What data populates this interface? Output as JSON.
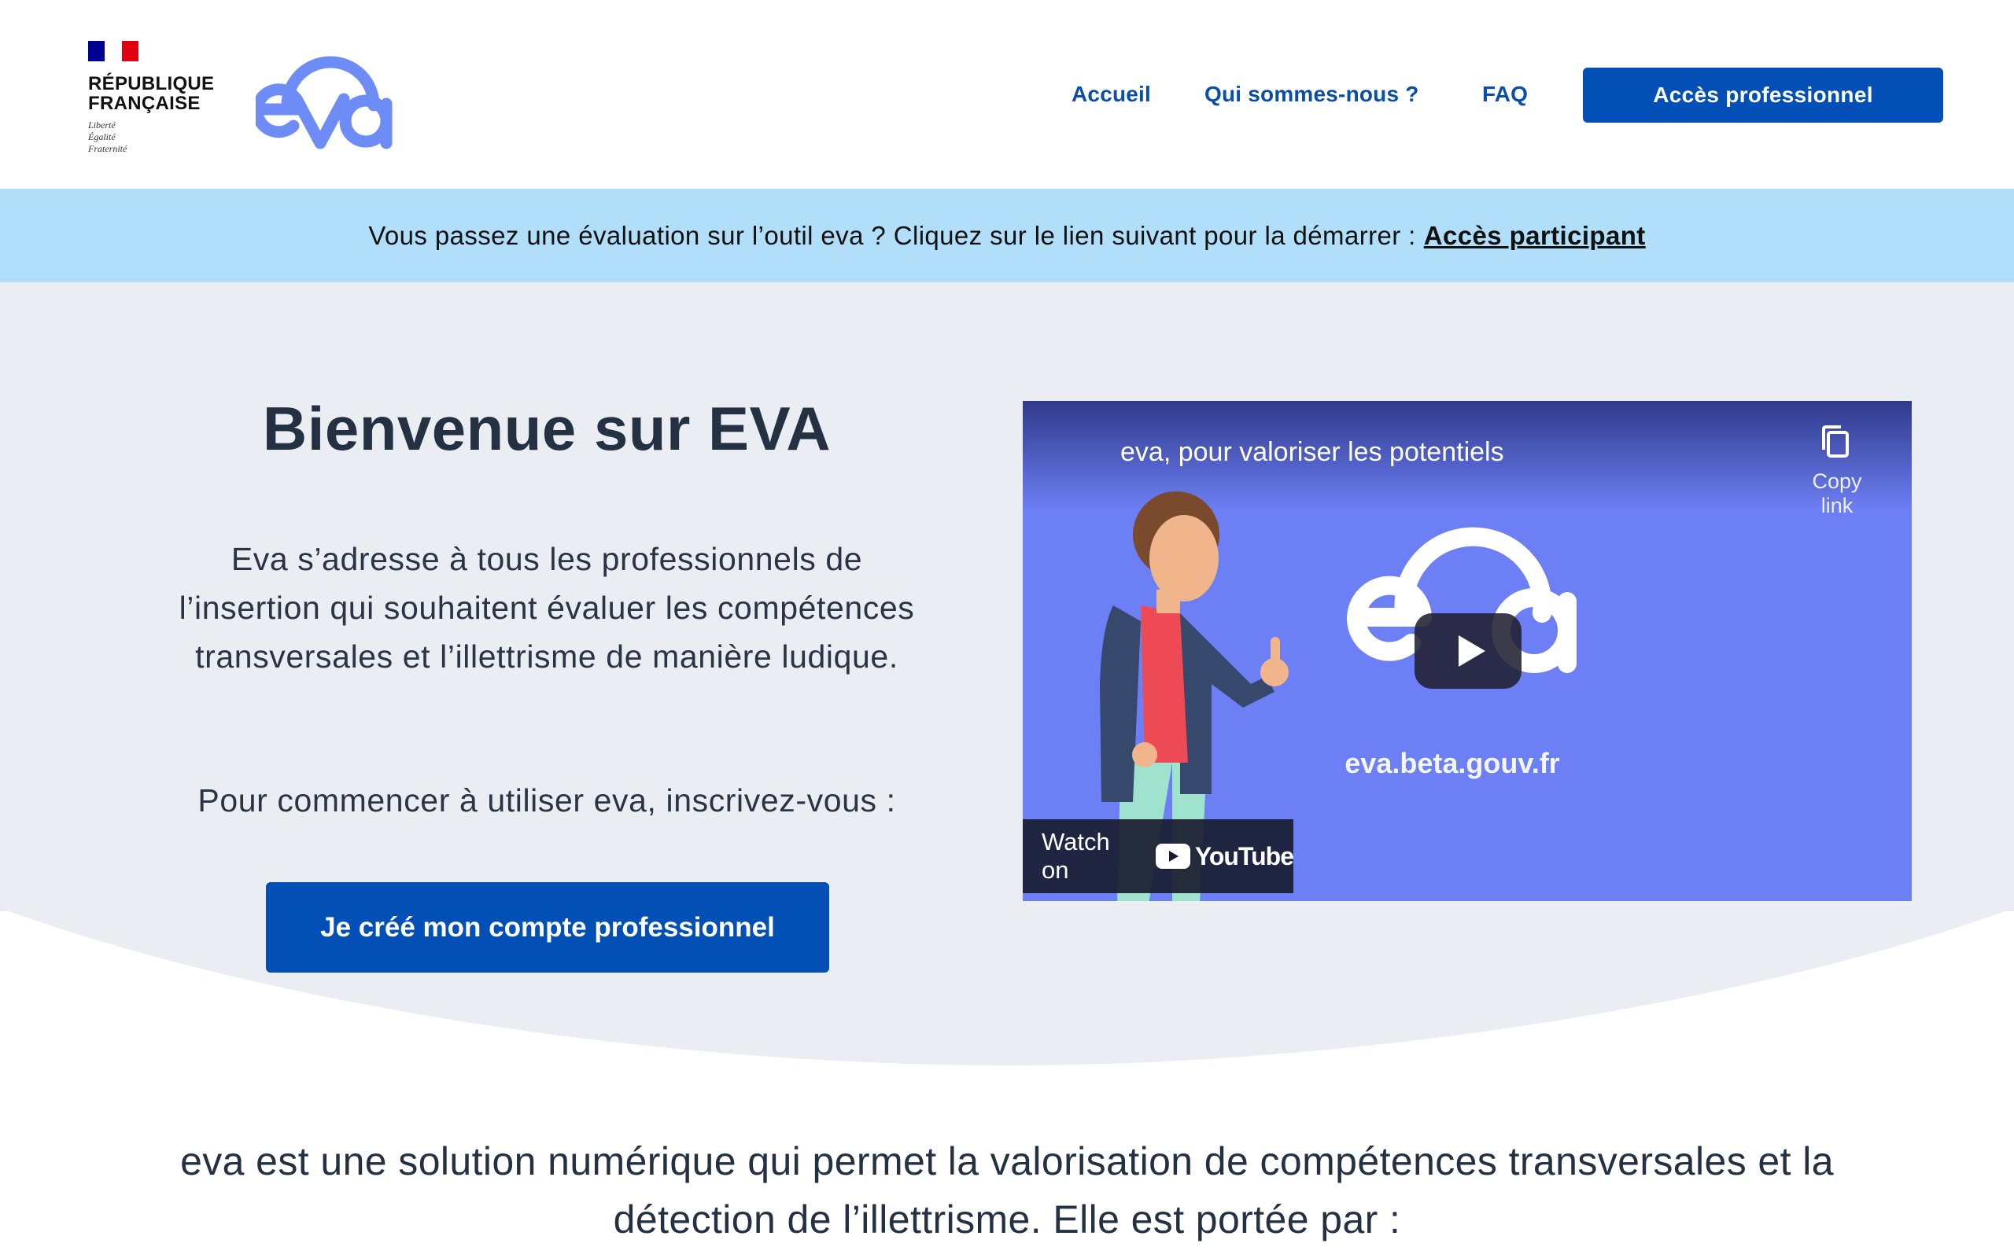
{
  "header": {
    "gov": {
      "line1": "RÉPUBLIQUE",
      "line2": "FRANÇAISE",
      "motto1": "Liberté",
      "motto2": "Égalité",
      "motto3": "Fraternité"
    },
    "logo_alt": "eva",
    "nav": [
      "Accueil",
      "Qui sommes-nous ?",
      "FAQ"
    ],
    "pro_button": "Accès professionnel"
  },
  "banner": {
    "text": "Vous passez une évaluation sur l’outil eva ? Cliquez sur le lien suivant pour la démarrer :",
    "link": "Accès participant"
  },
  "hero": {
    "title": "Bienvenue sur EVA",
    "description": "Eva s’adresse à tous les professionnels de l’insertion qui souhaitent évaluer les compétences transversales et l’illettrisme de manière ludique.",
    "cta_text": "Pour commencer à utiliser eva, inscrivez-vous  :",
    "cta_button": "Je créé mon compte professionnel"
  },
  "video": {
    "title": "eva, pour valoriser les potentiels",
    "copy_link": "Copy link",
    "url_text": "eva.beta.gouv.fr",
    "watch_on": "Watch on",
    "youtube": "YouTube"
  },
  "intro": {
    "text": "eva est une solution numérique qui permet la valorisation de compétences transversales et la détection de l’illettrisme. Elle est portée par :"
  },
  "colors": {
    "primary": "#0250b5",
    "banner_bg": "#b1def9",
    "hero_bg": "#eaedf2",
    "video_bg": "#6d7ff5",
    "eva_logo": "#6d8cf5"
  },
  "icons": {
    "copy": "copy-icon",
    "play": "play-icon",
    "youtube": "youtube-icon"
  }
}
